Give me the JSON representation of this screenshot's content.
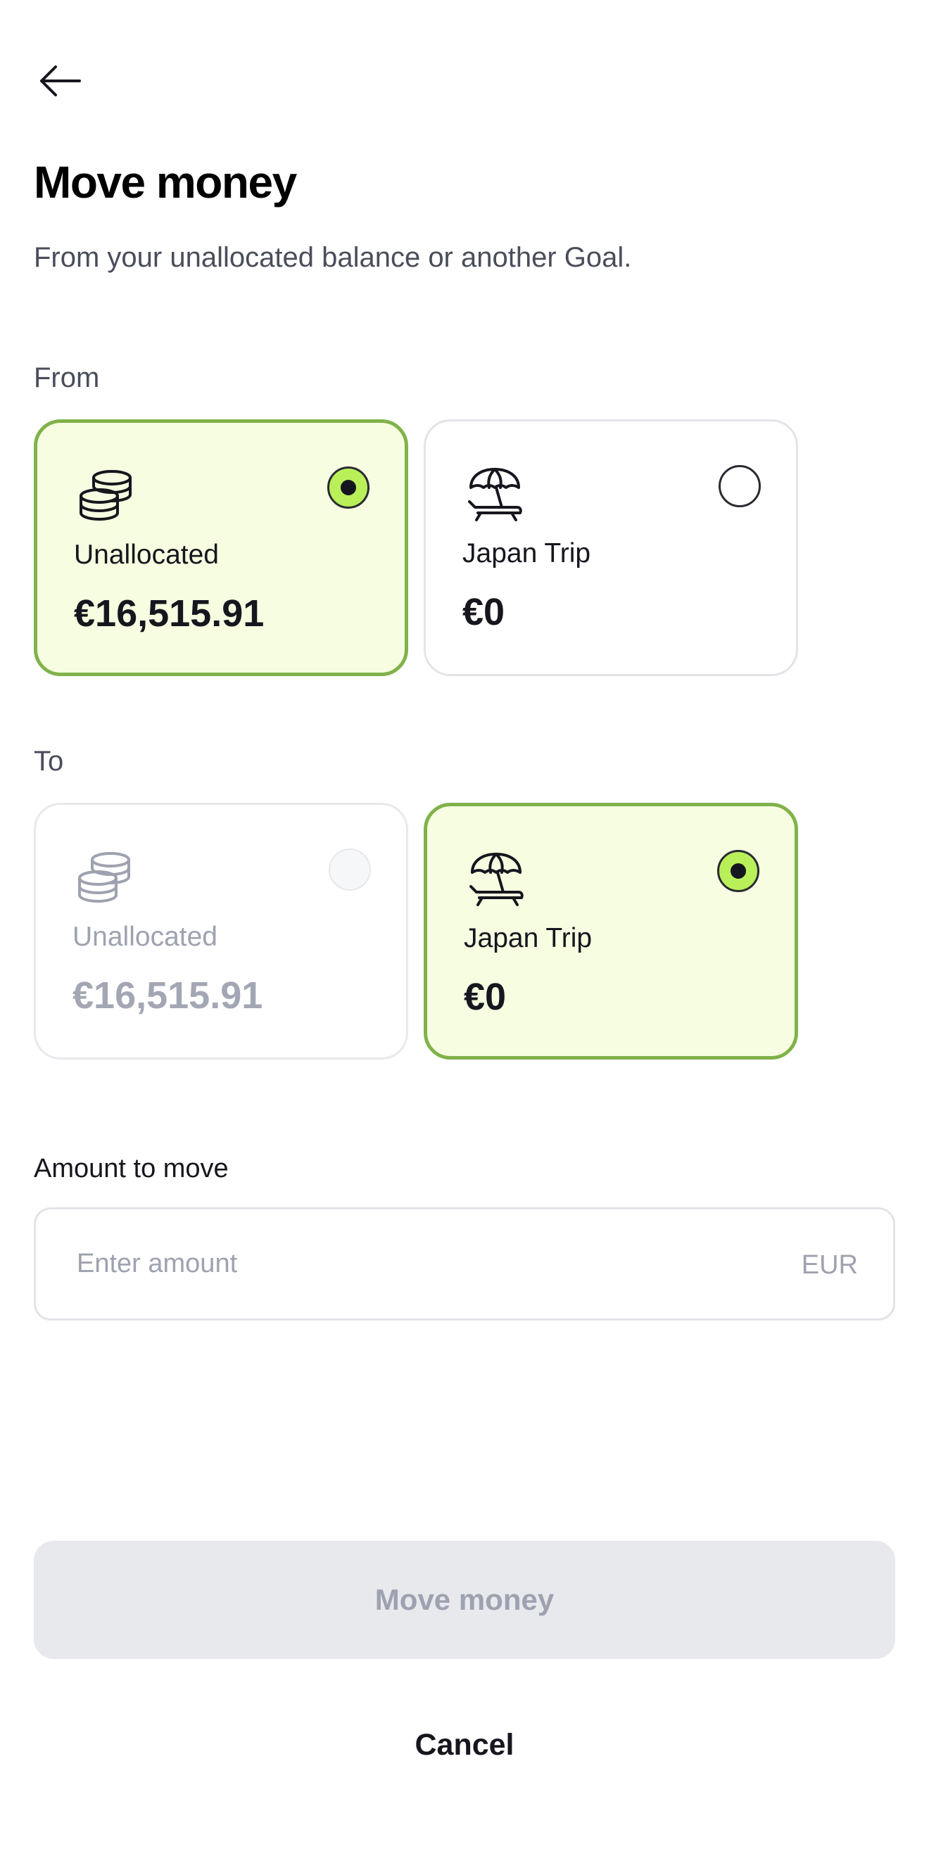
{
  "header": {
    "back_icon": "arrow-left-icon"
  },
  "page": {
    "title": "Move money",
    "subtitle": "From your unallocated balance or another Goal."
  },
  "from": {
    "label": "From",
    "options": [
      {
        "icon": "coins-stack-icon",
        "label": "Unallocated",
        "amount": "€16,515.91",
        "selected": true,
        "disabled": false
      },
      {
        "icon": "beach-umbrella-icon",
        "label": "Japan Trip",
        "amount": "€0",
        "selected": false,
        "disabled": false
      }
    ]
  },
  "to": {
    "label": "To",
    "options": [
      {
        "icon": "coins-stack-icon",
        "label": "Unallocated",
        "amount": "€16,515.91",
        "selected": false,
        "disabled": true
      },
      {
        "icon": "beach-umbrella-icon",
        "label": "Japan Trip",
        "amount": "€0",
        "selected": true,
        "disabled": false
      }
    ]
  },
  "amount": {
    "label": "Amount to move",
    "value": "",
    "placeholder": "Enter amount",
    "currency": "EUR"
  },
  "actions": {
    "primary_label": "Move money",
    "primary_enabled": false,
    "cancel_label": "Cancel"
  },
  "colors": {
    "selected_background": "#f6fde0",
    "selected_border": "#80b24a",
    "radio_fill": "#b9f05a",
    "disabled_text": "#9ea2b0"
  }
}
